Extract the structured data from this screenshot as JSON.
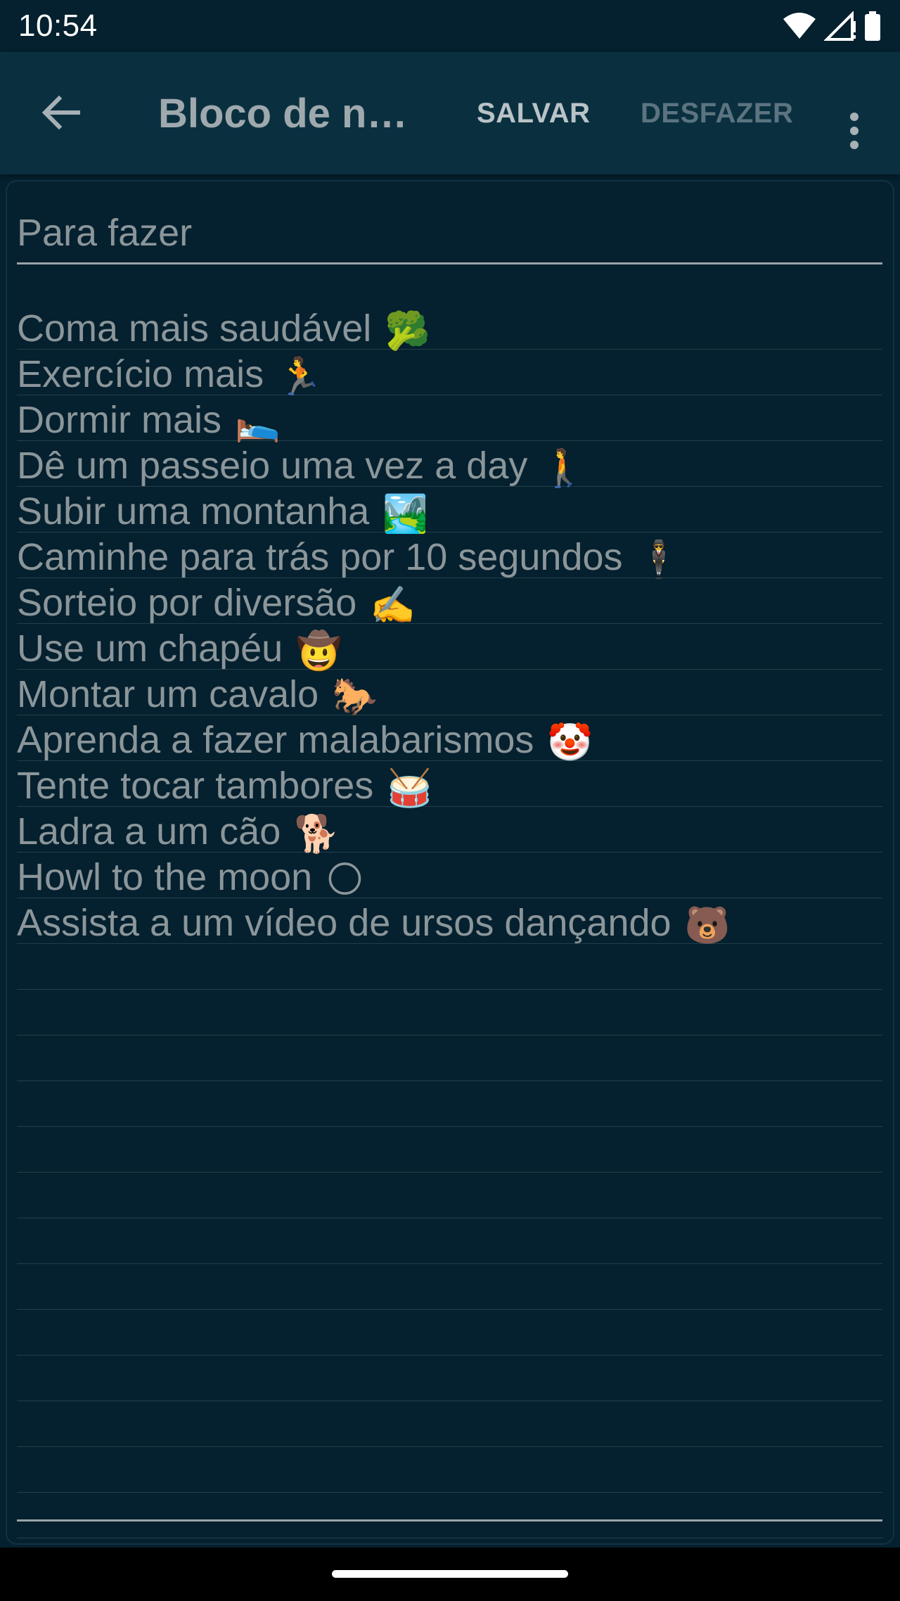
{
  "status_bar": {
    "time": "10:54",
    "icons": [
      "wifi-icon",
      "signal-icon",
      "battery-icon"
    ]
  },
  "app_bar": {
    "back_icon": "arrow-back-icon",
    "title": "Bloco de no…",
    "save_label": "SALVAR",
    "undo_label": "DESFAZER",
    "overflow_icon": "more-vert-icon"
  },
  "note": {
    "title": "Para fazer",
    "lines": [
      {
        "text": "Coma mais saudável",
        "emoji": "🥦"
      },
      {
        "text": "Exercício mais",
        "emoji": "🏃"
      },
      {
        "text": "Dormir mais",
        "emoji": "🛌"
      },
      {
        "text": "Dê um passeio uma vez a day",
        "emoji": "🚶"
      },
      {
        "text": "Subir uma montanha",
        "emoji": "🏞️"
      },
      {
        "text": "Caminhe para trás por 10 segundos",
        "emoji": "🕴️"
      },
      {
        "text": "Sorteio por diversão",
        "emoji": "✍️"
      },
      {
        "text": "Use um chapéu",
        "emoji": "🤠"
      },
      {
        "text": "Montar um cavalo",
        "emoji": "🐎"
      },
      {
        "text": "Aprenda a fazer malabarismos",
        "emoji": "🤡"
      },
      {
        "text": "Tente tocar tambores",
        "emoji": "🥁"
      },
      {
        "text": "Ladra a um cão",
        "emoji": "🐕"
      },
      {
        "text": "Howl to the moon",
        "emoji": "🌕"
      },
      {
        "text": "Assista a um vídeo de ursos dançando",
        "emoji": "🐻"
      }
    ],
    "empty_line_count": 13
  },
  "colors": {
    "background": "#05202e",
    "app_bar": "#0a3040",
    "text": "#8b969a",
    "ruled_line": "#23404d"
  }
}
